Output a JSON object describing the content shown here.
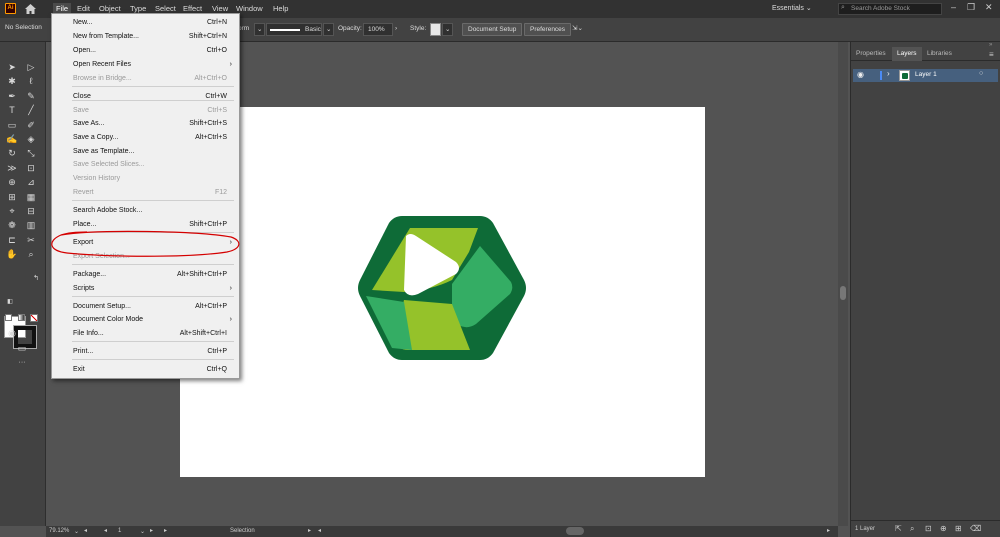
{
  "app": {
    "icon_text": "Ai"
  },
  "menubar": {
    "items": [
      "File",
      "Edit",
      "Object",
      "Type",
      "Select",
      "Effect",
      "View",
      "Window",
      "Help"
    ],
    "workspace": "Essentials",
    "search_placeholder": "Search Adobe Stock"
  },
  "controlbar": {
    "selection_status": "No Selection",
    "partial_label": "orm",
    "stroke_style": "Basic",
    "opacity_label": "Opacity:",
    "opacity_value": "100%",
    "style_label": "Style:",
    "document_setup": "Document Setup",
    "preferences": "Preferences"
  },
  "file_menu": {
    "items": [
      {
        "label": "New...",
        "shortcut": "Ctrl+N",
        "enabled": true
      },
      {
        "label": "New from Template...",
        "shortcut": "Shift+Ctrl+N",
        "enabled": true
      },
      {
        "label": "Open...",
        "shortcut": "Ctrl+O",
        "enabled": true
      },
      {
        "label": "Open Recent Files",
        "shortcut": "",
        "submenu": true,
        "enabled": true
      },
      {
        "label": "Browse in Bridge...",
        "shortcut": "Alt+Ctrl+O",
        "enabled": false
      },
      {
        "label": "Close",
        "shortcut": "Ctrl+W",
        "enabled": true
      },
      {
        "label": "Save",
        "shortcut": "Ctrl+S",
        "enabled": false
      },
      {
        "label": "Save As...",
        "shortcut": "Shift+Ctrl+S",
        "enabled": true
      },
      {
        "label": "Save a Copy...",
        "shortcut": "Alt+Ctrl+S",
        "enabled": true
      },
      {
        "label": "Save as Template...",
        "shortcut": "",
        "enabled": true
      },
      {
        "label": "Save Selected Slices...",
        "shortcut": "",
        "enabled": false
      },
      {
        "label": "Version History",
        "shortcut": "",
        "enabled": false
      },
      {
        "label": "Revert",
        "shortcut": "F12",
        "enabled": false
      },
      {
        "label": "Search Adobe Stock...",
        "shortcut": "",
        "enabled": true
      },
      {
        "label": "Place...",
        "shortcut": "Shift+Ctrl+P",
        "enabled": true
      },
      {
        "label": "Export",
        "shortcut": "",
        "submenu": true,
        "enabled": true
      },
      {
        "label": "Export Selection...",
        "shortcut": "",
        "enabled": false
      },
      {
        "label": "Package...",
        "shortcut": "Alt+Shift+Ctrl+P",
        "enabled": true
      },
      {
        "label": "Scripts",
        "shortcut": "",
        "submenu": true,
        "enabled": true
      },
      {
        "label": "Document Setup...",
        "shortcut": "Alt+Ctrl+P",
        "enabled": true
      },
      {
        "label": "Document Color Mode",
        "shortcut": "",
        "submenu": true,
        "enabled": true
      },
      {
        "label": "File Info...",
        "shortcut": "Alt+Shift+Ctrl+I",
        "enabled": true
      },
      {
        "label": "Print...",
        "shortcut": "Ctrl+P",
        "enabled": true
      },
      {
        "label": "Exit",
        "shortcut": "Ctrl+Q",
        "enabled": true
      }
    ]
  },
  "panels": {
    "tabs": [
      "Properties",
      "Layers",
      "Libraries"
    ],
    "active_tab": "Layers",
    "layer_name": "Layer 1",
    "footer_count": "1 Layer"
  },
  "statusbar": {
    "zoom": "79.12%",
    "artboard_number": "1",
    "tool": "Selection"
  },
  "colors": {
    "logo_dark": "#0e6b37",
    "logo_mid": "#34ad64",
    "logo_lime": "#95c22a",
    "highlight_circle": "#d40000"
  }
}
